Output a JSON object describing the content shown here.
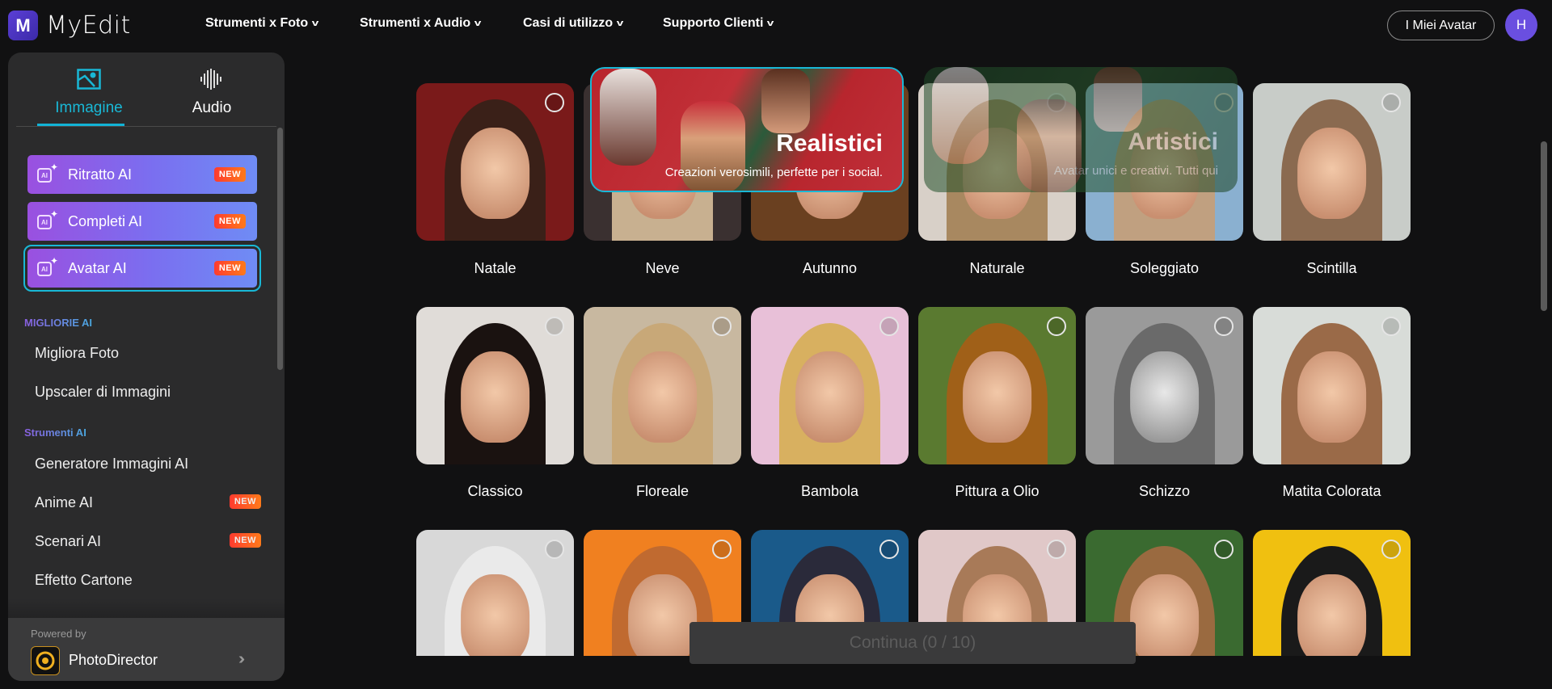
{
  "header": {
    "logo_mark": "M",
    "logo_text": "MyEdit",
    "nav": [
      "Strumenti x Foto",
      "Strumenti x Audio",
      "Casi di utilizzo",
      "Supporto Clienti"
    ],
    "my_avatars": "I Miei Avatar",
    "user_initial": "H"
  },
  "sidebar": {
    "tabs": [
      {
        "label": "Immagine",
        "active": true
      },
      {
        "label": "Audio",
        "active": false
      }
    ],
    "ai_buttons": [
      {
        "label": "Ritratto AI",
        "badge": "NEW"
      },
      {
        "label": "Completi AI",
        "badge": "NEW"
      },
      {
        "label": "Avatar AI",
        "badge": "NEW",
        "selected": true
      }
    ],
    "icon_text": "AI",
    "sections": [
      {
        "title": "MIGLIORIE AI",
        "items": [
          {
            "label": "Migliora Foto"
          },
          {
            "label": "Upscaler di Immagini"
          }
        ]
      },
      {
        "title": "Strumenti AI",
        "items": [
          {
            "label": "Generatore Immagini AI"
          },
          {
            "label": "Anime AI",
            "badge": "NEW"
          },
          {
            "label": "Scenari AI",
            "badge": "NEW"
          },
          {
            "label": "Effetto Cartone"
          }
        ]
      }
    ],
    "footer": {
      "powered_by": "Powered by",
      "product": "PhotoDirector"
    }
  },
  "banners": [
    {
      "title": "Realistici",
      "subtitle": "Creazioni verosimili, perfette per i social.",
      "selected": true
    },
    {
      "title": "Artistici",
      "subtitle": "Avatar unici e creativi. Tutti qui",
      "selected": false
    }
  ],
  "styles": {
    "row0": [
      "Natale",
      "Neve",
      "Autunno",
      "Naturale",
      "Soleggiato",
      "Scintilla"
    ],
    "row1": [
      "Classico",
      "Floreale",
      "Bambola",
      "Pittura a Olio",
      "Schizzo",
      "Matita Colorata"
    ]
  },
  "continue_button": "Continua (0 / 10)",
  "colors": {
    "accent": "#19b8d6",
    "purple": "#6a4fe0",
    "new_badge": "#ff3b2f"
  }
}
